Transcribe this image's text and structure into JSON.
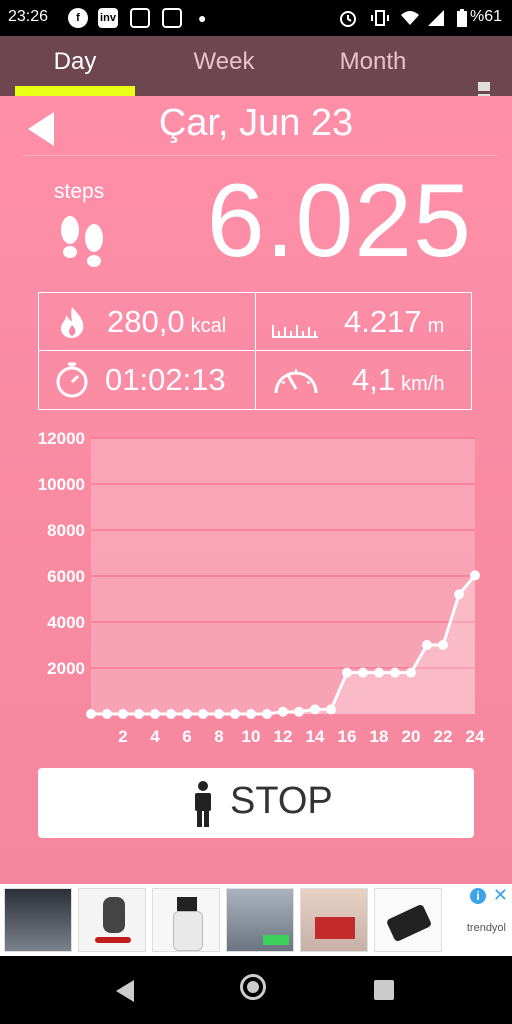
{
  "status_bar": {
    "time": "23:26",
    "notification_icons": [
      "facebook-icon",
      "inv-icon",
      "instagram-icon",
      "instagram-icon"
    ],
    "inv_text": "inv",
    "battery": "%61"
  },
  "tabs": [
    {
      "label": "Day",
      "active": true
    },
    {
      "label": "Week",
      "active": false
    },
    {
      "label": "Month",
      "active": false
    }
  ],
  "date": "Çar, Jun 23",
  "steps": {
    "label": "steps",
    "value": "6.025"
  },
  "stats": {
    "calories": {
      "value": "280,0",
      "unit": "kcal"
    },
    "distance": {
      "value": "4.217",
      "unit": "m"
    },
    "duration": {
      "value": "01:02:13"
    },
    "speed": {
      "value": "4,1",
      "unit": "km/h"
    }
  },
  "chart_data": {
    "type": "area",
    "x": [
      0,
      1,
      2,
      3,
      4,
      5,
      6,
      7,
      8,
      9,
      10,
      11,
      12,
      13,
      14,
      15,
      16,
      17,
      18,
      19,
      20,
      21,
      22,
      23,
      24
    ],
    "values": [
      0,
      0,
      0,
      0,
      0,
      0,
      0,
      0,
      0,
      0,
      0,
      0,
      100,
      100,
      200,
      200,
      1800,
      1800,
      1800,
      1800,
      1800,
      3000,
      3000,
      5200,
      6025
    ],
    "x_tick_labels": [
      "2",
      "4",
      "6",
      "8",
      "10",
      "12",
      "14",
      "16",
      "18",
      "20",
      "22",
      "24"
    ],
    "y_tick_labels": [
      "12000",
      "10000",
      "8000",
      "6000",
      "4000",
      "2000"
    ],
    "ylim": [
      0,
      12000
    ],
    "xlim": [
      0,
      24
    ],
    "grid": true
  },
  "stop_button": {
    "label": "STOP"
  },
  "ad": {
    "brand": "trendyol",
    "info": "i",
    "close": "✕"
  },
  "colors": {
    "accent": "#eaff16",
    "background": "#f38aa6",
    "tabbar": "#6e4650"
  }
}
